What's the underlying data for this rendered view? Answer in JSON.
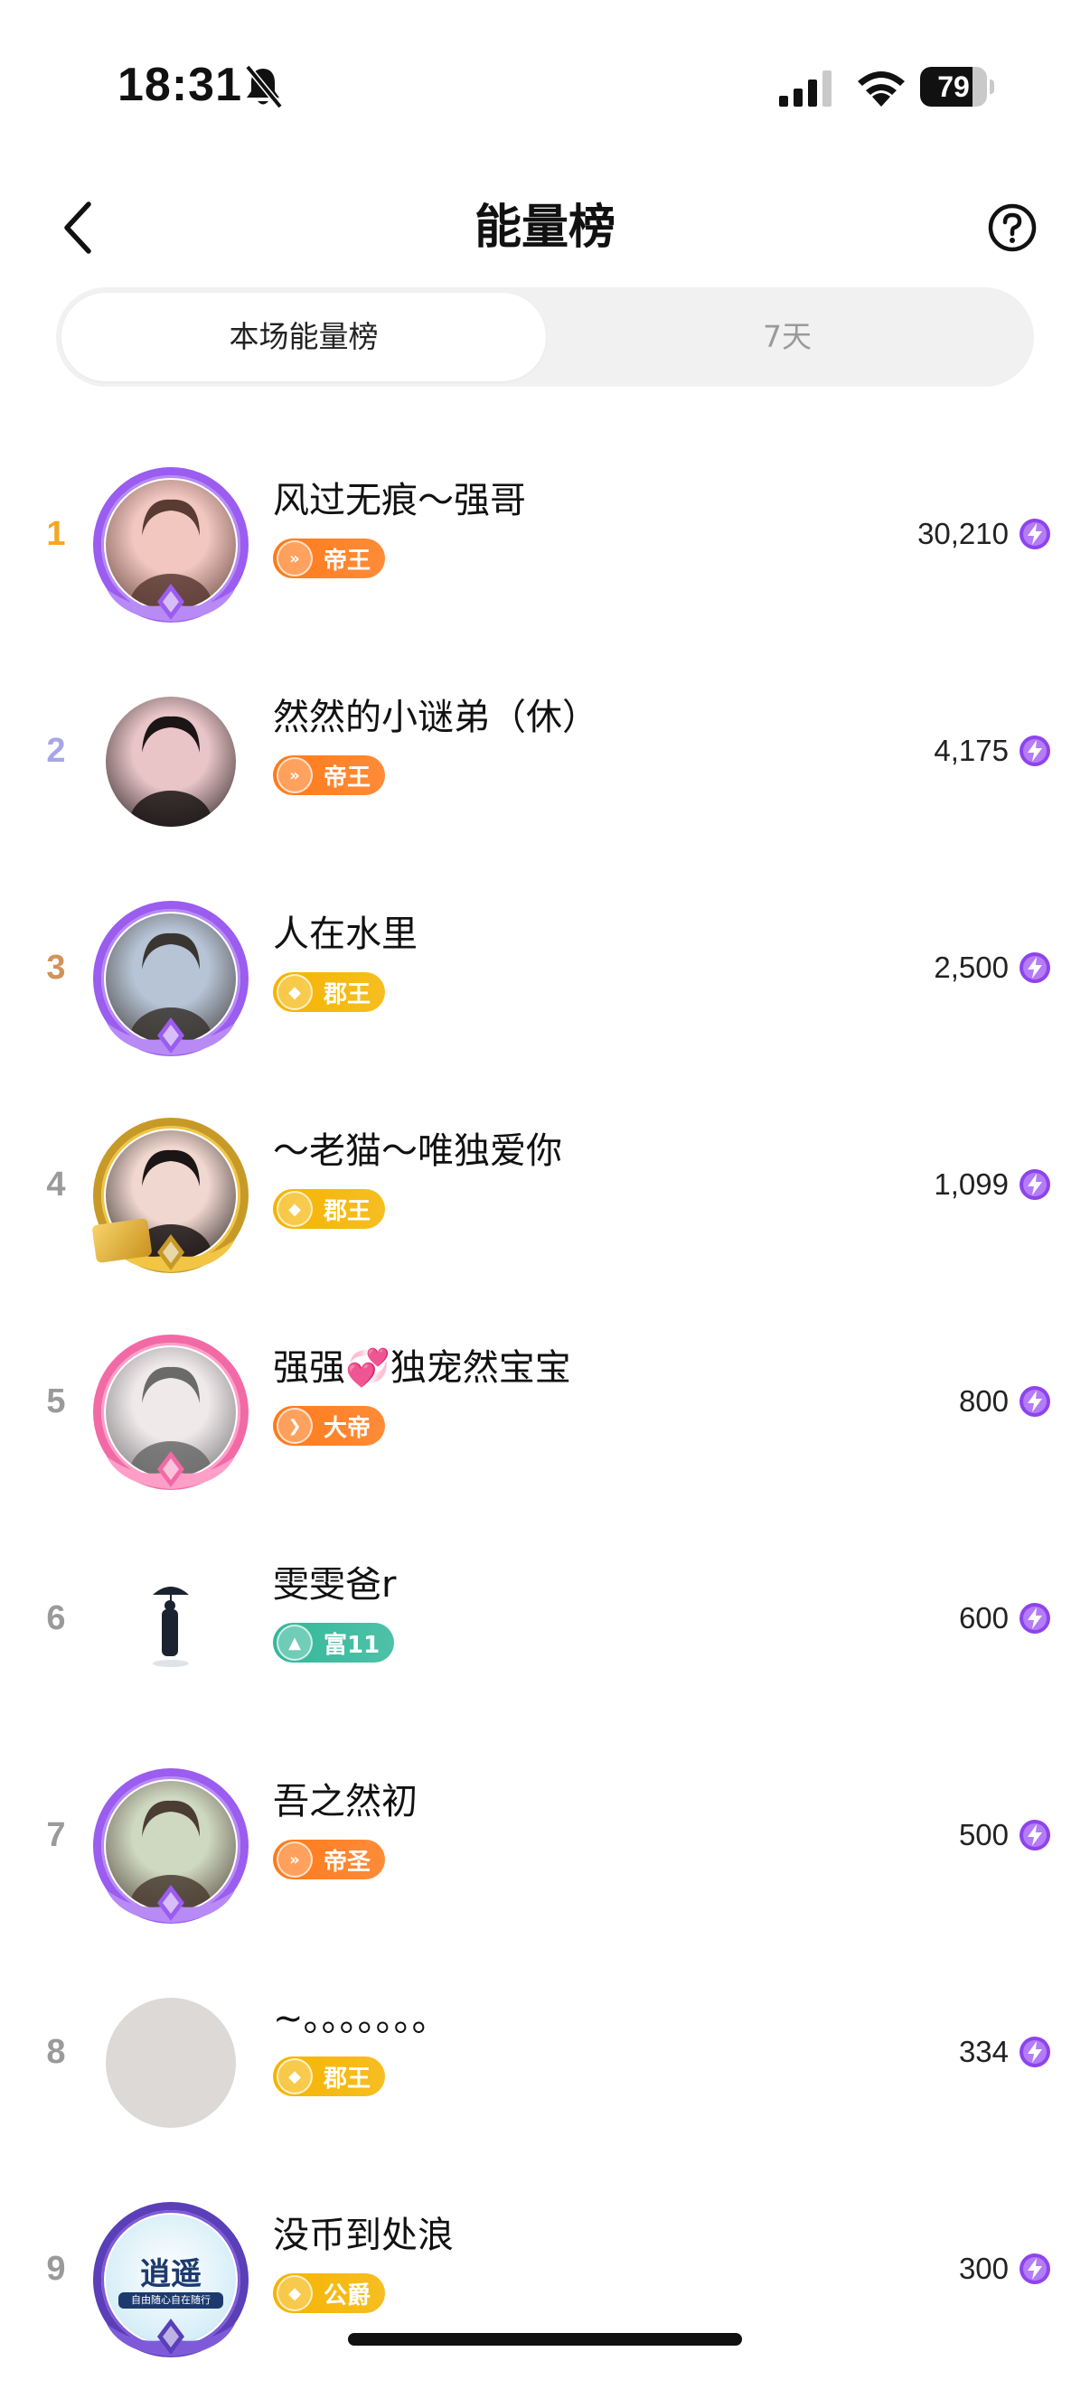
{
  "status_bar": {
    "time": "18:31",
    "battery": "79",
    "battery_percent": 79
  },
  "header": {
    "title": "能量榜"
  },
  "tabs": [
    {
      "label": "本场能量榜",
      "active": true
    },
    {
      "label": "7天",
      "active": false
    }
  ],
  "leaderboard": [
    {
      "rank": "1",
      "name": "风过无痕～强哥",
      "badge": "帝王",
      "score": "30,210",
      "rank_color": "#f5a623",
      "badge_color": "#ff7a1a",
      "frame": "purple-crown",
      "avatar_colors": [
        "#f1c7c0",
        "#5a3b34"
      ]
    },
    {
      "rank": "2",
      "name": "然然的小谜弟（休）",
      "badge": "帝王",
      "score": "4,175",
      "rank_color": "#a8a6e8",
      "badge_color": "#ff7a1a",
      "frame": "none",
      "avatar_colors": [
        "#e9c5c7",
        "#1b1515"
      ]
    },
    {
      "rank": "3",
      "name": "人在水里",
      "badge": "郡王",
      "score": "2,500",
      "rank_color": "#d2935b",
      "badge_color": "#f5b400",
      "frame": "purple-crown",
      "avatar_colors": [
        "#b7c4d6",
        "#3a3530"
      ]
    },
    {
      "rank": "4",
      "name": "～老猫～唯独爱你",
      "badge": "郡王",
      "score": "1,099",
      "rank_color": "#9a9a9a",
      "badge_color": "#f5b400",
      "frame": "gold-purple",
      "avatar_colors": [
        "#f0d7cf",
        "#1b1515"
      ]
    },
    {
      "rank": "5",
      "name": "强强💞独宠然宝宝",
      "badge": "大帝",
      "score": "800",
      "rank_color": "#9a9a9a",
      "badge_color": "#ff7a1a",
      "frame": "pink-heart",
      "avatar_colors": [
        "#efe9ea",
        "#6a6a6a"
      ]
    },
    {
      "rank": "6",
      "name": "雯雯爸r",
      "badge": "富11",
      "score": "600",
      "rank_color": "#9a9a9a",
      "badge_color": "#33b89a",
      "frame": "none",
      "avatar_colors": [
        "#ffffff",
        "#1c2330"
      ]
    },
    {
      "rank": "7",
      "name": "吾之然初",
      "badge": "帝圣",
      "score": "500",
      "rank_color": "#9a9a9a",
      "badge_color": "#ff7a1a",
      "frame": "purple-crown",
      "avatar_colors": [
        "#cfd9c2",
        "#4b3d33"
      ]
    },
    {
      "rank": "8",
      "name": "~。。。。。。。",
      "badge": "郡王",
      "score": "334",
      "rank_color": "#9a9a9a",
      "badge_color": "#f5b400",
      "frame": "none",
      "avatar_colors": [
        "#dcd9d7",
        "#dcd9d7"
      ]
    },
    {
      "rank": "9",
      "name": "没币到处浪",
      "badge": "公爵",
      "score": "300",
      "rank_color": "#9a9a9a",
      "badge_color": "#f5b400",
      "frame": "blue-shield",
      "avatar_colors": [
        "#d6eef8",
        "#1c3a6e"
      ],
      "avatar_text": "逍遥",
      "avatar_subtext": "自由随心自在随行"
    }
  ],
  "colors": {
    "accent_purple": "#8e44ec",
    "tab_bg": "#f1f1f1"
  }
}
